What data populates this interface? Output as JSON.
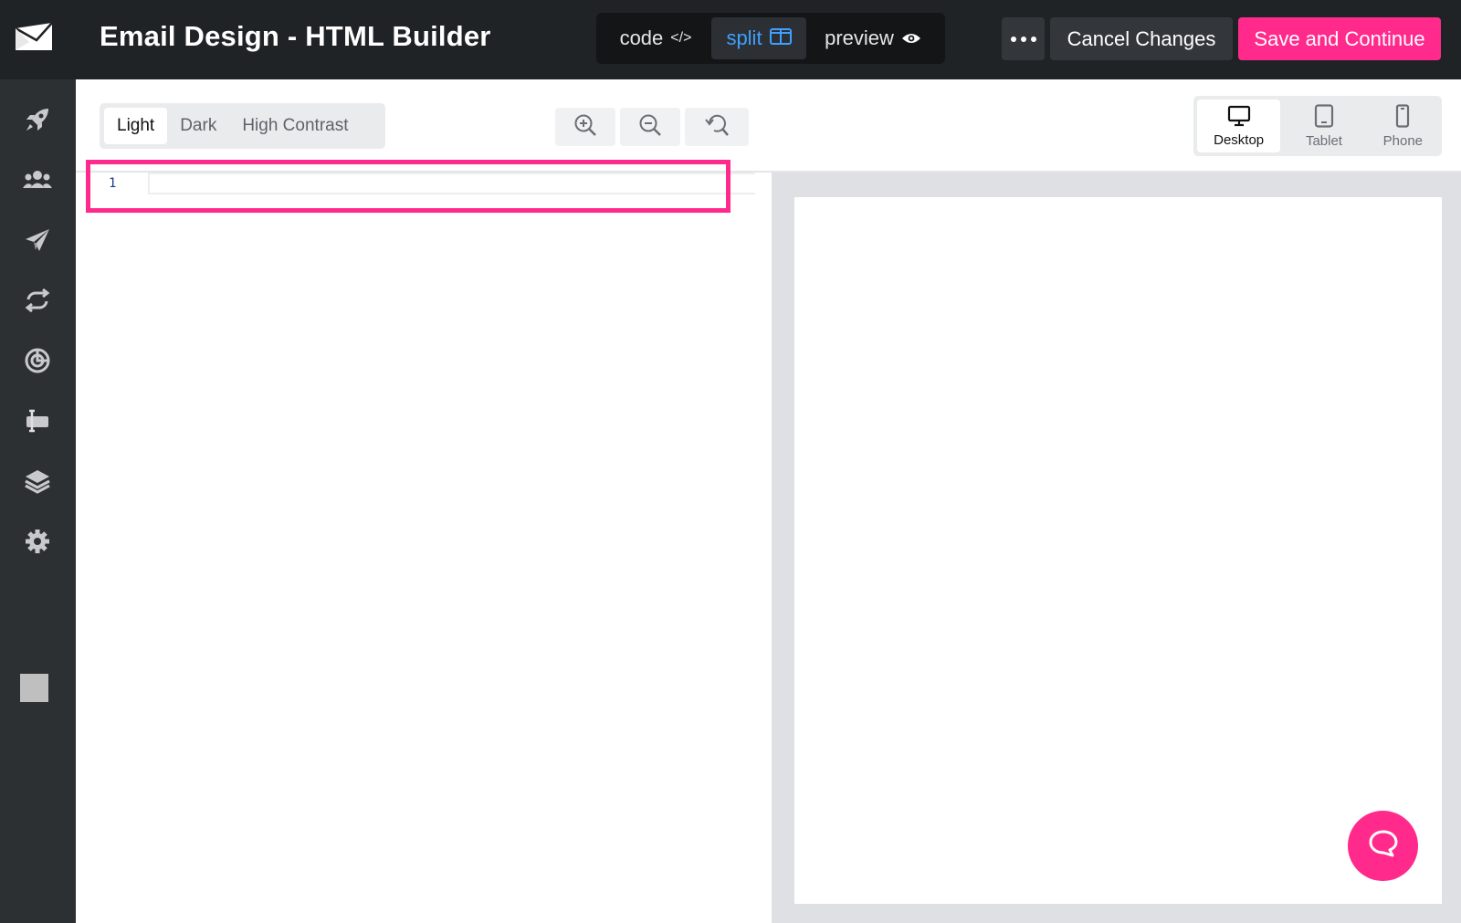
{
  "app": {
    "title": "Email Design - HTML Builder"
  },
  "view_modes": [
    {
      "label": "code",
      "glyph": "</>",
      "icon": "code-icon"
    },
    {
      "label": "split",
      "icon": "split-view-icon",
      "active": true
    },
    {
      "label": "preview",
      "icon": "eye-icon"
    }
  ],
  "header_actions": {
    "more": "more-options-icon",
    "cancel_label": "Cancel Changes",
    "save_label": "Save and Continue"
  },
  "colors": {
    "accent": "#ff2a8c",
    "topbar": "#202326",
    "sidebar": "#2d3033",
    "active_mode": "#3ea0ff"
  },
  "sidebar": {
    "items": [
      {
        "icon": "rocket-icon"
      },
      {
        "icon": "contacts-icon"
      },
      {
        "icon": "paper-plane-icon"
      },
      {
        "icon": "automation-loop-icon"
      },
      {
        "icon": "reports-icon"
      },
      {
        "icon": "text-tool-icon"
      },
      {
        "icon": "layers-icon"
      },
      {
        "icon": "gear-icon"
      },
      {
        "icon": "account-square-icon"
      }
    ]
  },
  "themes": [
    {
      "label": "Light",
      "active": true
    },
    {
      "label": "Dark"
    },
    {
      "label": "High Contrast"
    }
  ],
  "zoom_controls": [
    {
      "icon": "zoom-in-icon"
    },
    {
      "icon": "zoom-out-icon"
    },
    {
      "icon": "reset-zoom-icon"
    }
  ],
  "devices": [
    {
      "label": "Desktop",
      "icon": "desktop-icon",
      "active": true
    },
    {
      "label": "Tablet",
      "icon": "tablet-icon"
    },
    {
      "label": "Phone",
      "icon": "phone-icon"
    }
  ],
  "editor": {
    "line_numbers": [
      "1"
    ]
  }
}
